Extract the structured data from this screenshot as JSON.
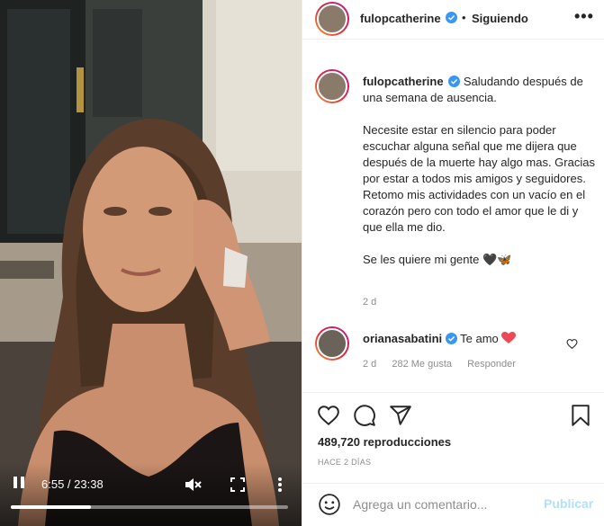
{
  "video": {
    "time": "6:55 / 23:38",
    "progress": 0.29
  },
  "post": {
    "author": "fulopcatherine",
    "follow_dot": "•",
    "follow_status": "Siguiendo",
    "options": "•••",
    "caption": {
      "username": "fulopcatherine",
      "line1": "Saludando después de una semana de ausencia.",
      "para2": "Necesite estar en silencio para poder escuchar alguna señal que me dijera que después de la muerte hay algo mas. Gracias por estar a todos mis amigos y seguidores. Retomo mis actividades con un vacío en el corazón pero con todo el amor que le di y que ella me dio.",
      "para3": "Se les quiere mi gente",
      "para3_emoji": "🖤🦋",
      "time": "2 d"
    },
    "comment": {
      "username": "orianasabatini",
      "text": "Te amo",
      "time": "2 d",
      "likes": "282 Me gusta",
      "reply": "Responder"
    },
    "views": "489,720 reproducciones",
    "posted_ago": "HACE 2 DÍAS",
    "composer": {
      "placeholder": "Agrega un comentario...",
      "publish": "Publicar"
    }
  },
  "colors": {
    "verified": "#3897f0",
    "link_disabled": "#b2dffc",
    "heart": "#ed4956",
    "muted_text": "#8e8e8e"
  },
  "icons": [
    "pause-icon",
    "mute-icon",
    "fullscreen-icon",
    "more-vertical-icon",
    "verified-badge-icon",
    "more-horizontal-icon",
    "heart-icon",
    "comment-icon",
    "share-icon",
    "bookmark-icon",
    "emoji-icon"
  ]
}
